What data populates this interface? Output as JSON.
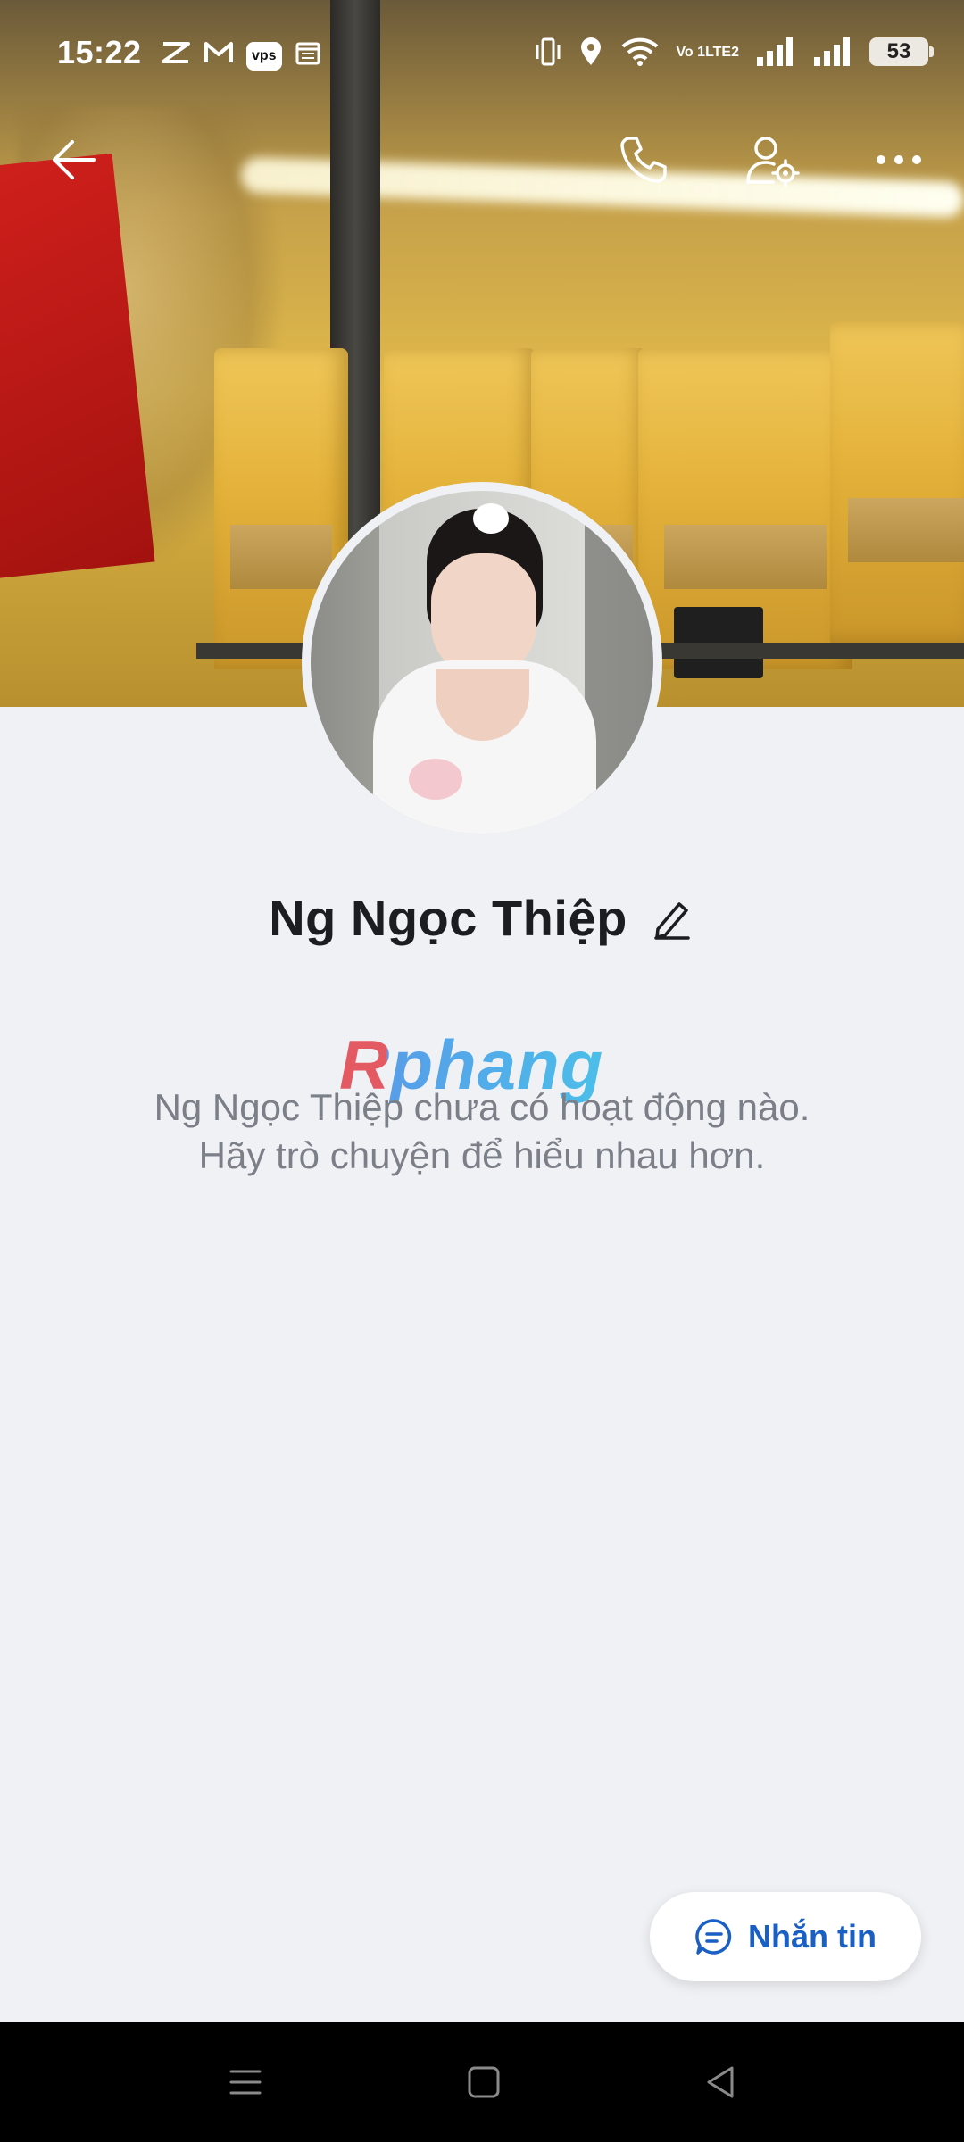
{
  "status_bar": {
    "time": "15:22",
    "notification_icons": [
      "capcut-icon",
      "gmail-icon",
      "vps-app-icon",
      "calendar-icon"
    ],
    "vps_label": "vps",
    "volte_line1": "Vo",
    "volte_line2": "LTE",
    "sim1_marker": "1",
    "sim2_marker": "2",
    "battery_level": "53"
  },
  "top_bar": {
    "icons": [
      "back-arrow-icon",
      "phone-icon",
      "user-settings-icon",
      "more-icon"
    ]
  },
  "profile": {
    "name": "Ng Ngọc Thiệp"
  },
  "watermark": {
    "text": "Rphang"
  },
  "empty_state": {
    "line1": "Ng Ngọc Thiệp chưa có hoạt động nào.",
    "line2": "Hãy trò chuyện để hiểu nhau hơn."
  },
  "message_button": {
    "label": "Nhắn tin"
  },
  "colors": {
    "accent": "#1a5fc4",
    "background": "#f0f1f5",
    "name_text": "#1c1d21",
    "secondary_text": "#7a7f88",
    "nav_bar": "#000000"
  }
}
